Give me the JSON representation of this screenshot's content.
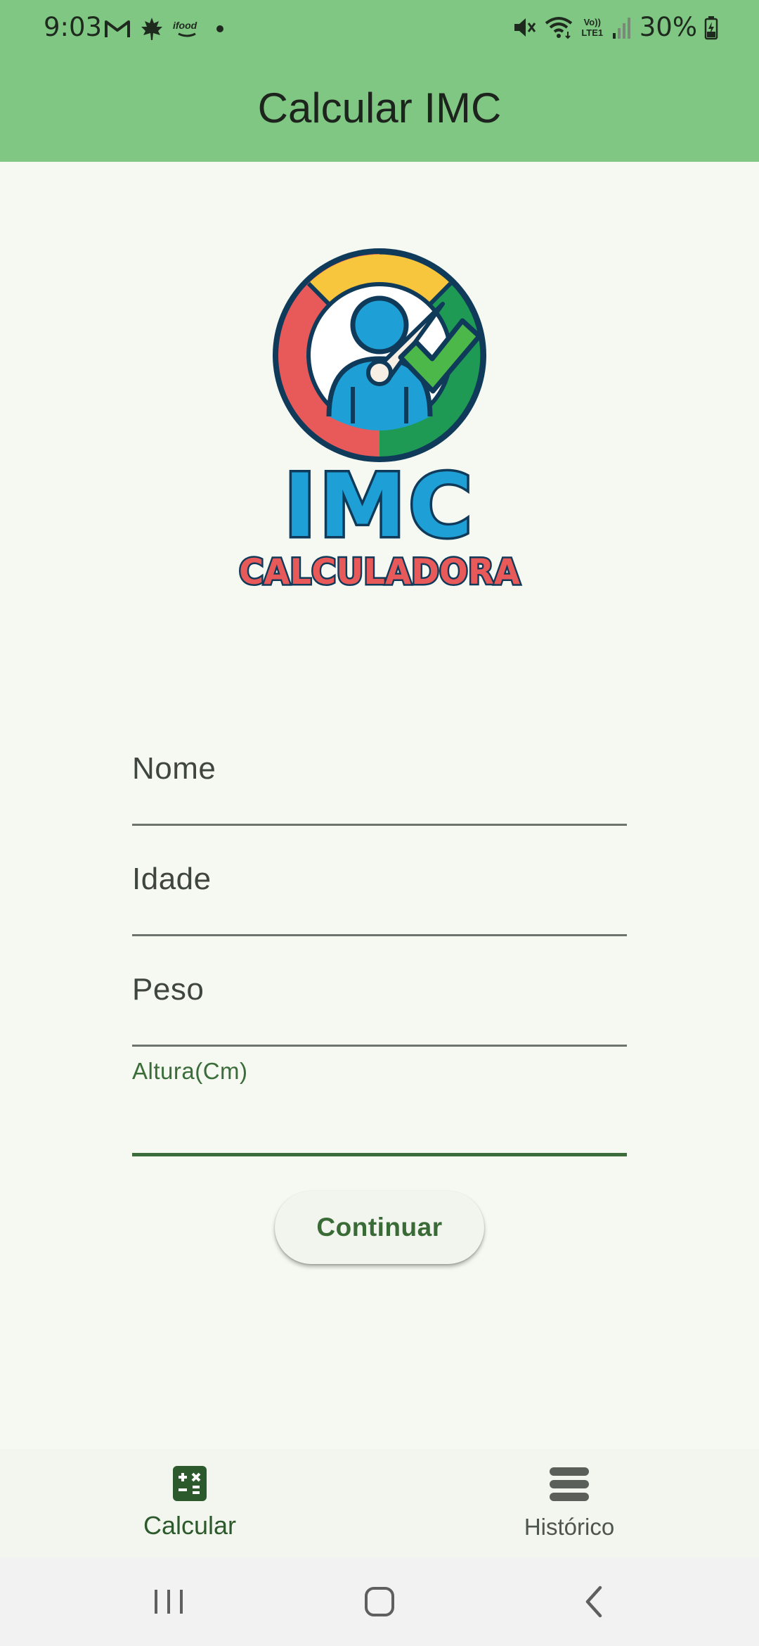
{
  "status_bar": {
    "time": "9:03",
    "left_icons": [
      "gmail-icon",
      "maple-leaf-icon",
      "ifood-icon",
      "notification-dot-icon"
    ],
    "right_icons": [
      "mute-icon",
      "wifi-icon",
      "volte-icon",
      "signal-icon",
      "battery-charging-icon"
    ],
    "battery": "30%",
    "ifood_text": "ifood",
    "volte_text": "Vo)) LTE1"
  },
  "app_bar": {
    "title": "Calcular IMC"
  },
  "logo": {
    "title": "IMC",
    "subtitle": "CALCULADORA"
  },
  "form": {
    "fields": [
      {
        "label": "Nome",
        "value": ""
      },
      {
        "label": "Idade",
        "value": ""
      },
      {
        "label": "Peso",
        "value": ""
      },
      {
        "label": "Altura(Cm)",
        "value": "",
        "focused": true
      }
    ],
    "submit_label": "Continuar"
  },
  "bottom_nav": {
    "items": [
      {
        "label": "Calcular",
        "icon": "calculator-icon",
        "selected": true
      },
      {
        "label": "Histórico",
        "icon": "list-icon",
        "selected": false
      }
    ]
  },
  "system_nav": [
    "recent-apps-icon",
    "home-icon",
    "back-icon"
  ],
  "colors": {
    "app_bar": "#81c784",
    "background": "#f6f9f1",
    "accent": "#3b6d3b",
    "logo_blue": "#1ea0d6",
    "logo_red": "#e85a5a",
    "logo_yellow": "#f8c63c",
    "logo_green": "#1f9a55",
    "logo_outline": "#0f3a5a"
  }
}
